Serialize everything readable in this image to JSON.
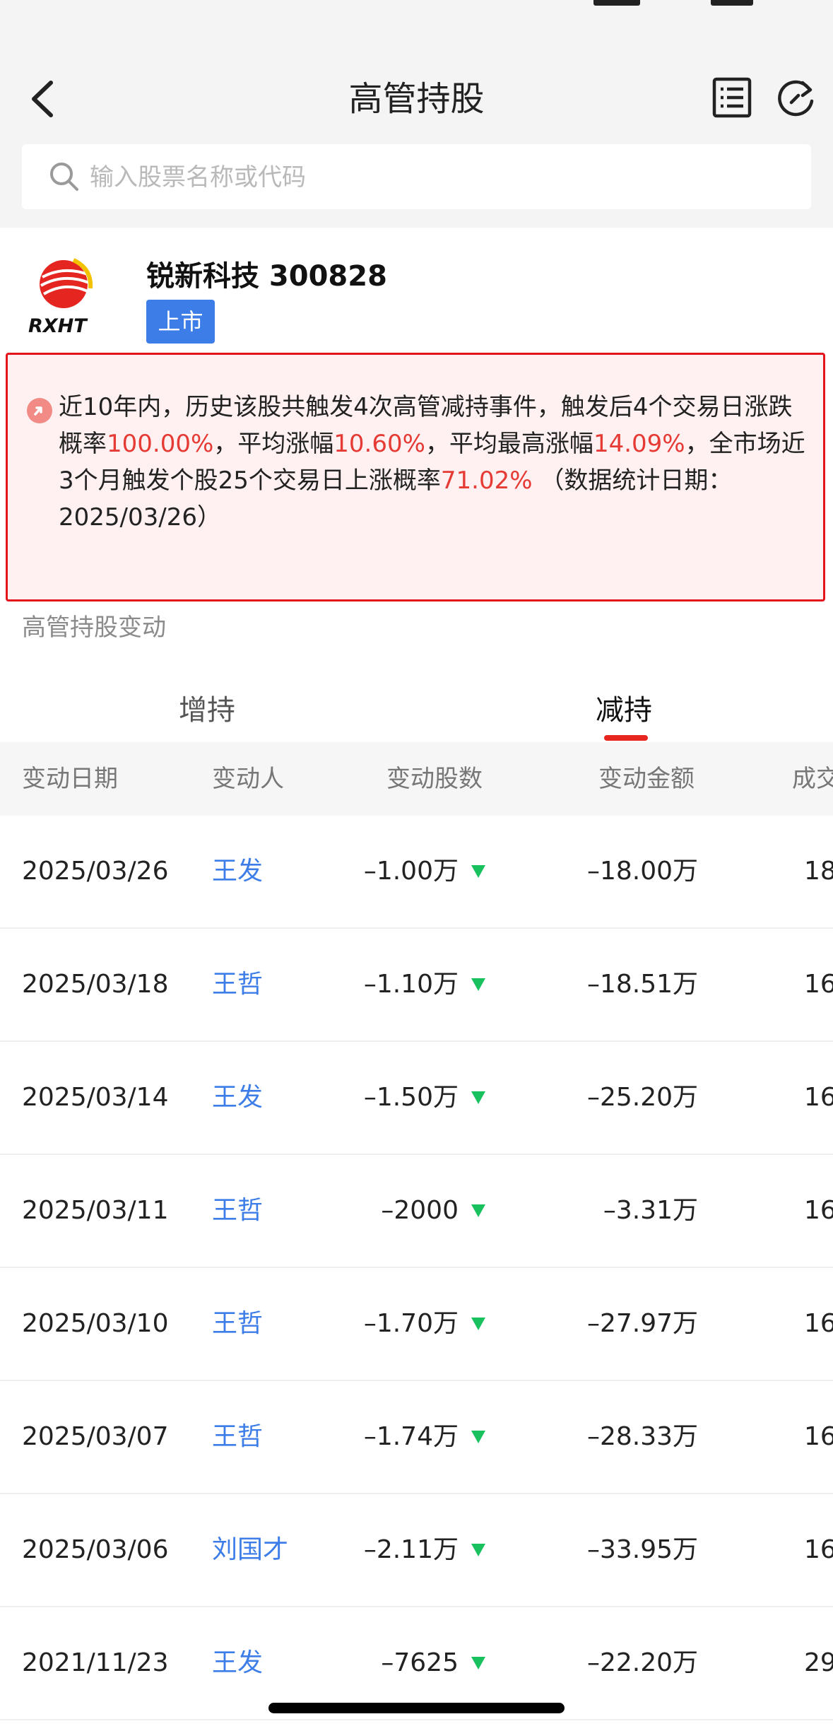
{
  "nav": {
    "title": "高管持股"
  },
  "search": {
    "placeholder": "输入股票名称或代码"
  },
  "stock": {
    "name": "锐新科技 300828",
    "badge": "上市",
    "logo_text": "RXHT"
  },
  "alert": {
    "p1": "近10年内，历史该股共触发4次高管减持事件，触发后4个交易日涨跌概率",
    "v1": "100.00%",
    "p2": "，平均涨幅",
    "v2": "10.60%",
    "p3": "，平均最高涨幅",
    "v3": "14.09%",
    "p4": "，全市场近3个月触发个股25个交易日上涨概率",
    "v4": "71.02%",
    "p5": " （数据统计日期：2025/03/26）"
  },
  "section": {
    "label": "高管持股变动"
  },
  "tabs": [
    {
      "label": "增持",
      "active": false
    },
    {
      "label": "减持",
      "active": true
    }
  ],
  "table": {
    "headers": [
      "变动日期",
      "变动人",
      "变动股数",
      "变动金额",
      "成交"
    ],
    "rows": [
      {
        "date": "2025/03/26",
        "person": "王发",
        "shares": "–1.00万",
        "amount": "–18.00万",
        "price": "18"
      },
      {
        "date": "2025/03/18",
        "person": "王哲",
        "shares": "–1.10万",
        "amount": "–18.51万",
        "price": "16"
      },
      {
        "date": "2025/03/14",
        "person": "王发",
        "shares": "–1.50万",
        "amount": "–25.20万",
        "price": "16"
      },
      {
        "date": "2025/03/11",
        "person": "王哲",
        "shares": "–2000",
        "amount": "–3.31万",
        "price": "16"
      },
      {
        "date": "2025/03/10",
        "person": "王哲",
        "shares": "–1.70万",
        "amount": "–27.97万",
        "price": "16"
      },
      {
        "date": "2025/03/07",
        "person": "王哲",
        "shares": "–1.74万",
        "amount": "–28.33万",
        "price": "16"
      },
      {
        "date": "2025/03/06",
        "person": "刘国才",
        "shares": "–2.11万",
        "amount": "–33.95万",
        "price": "16"
      },
      {
        "date": "2021/11/23",
        "person": "王发",
        "shares": "–7625",
        "amount": "–22.20万",
        "price": "29"
      }
    ]
  },
  "colors": {
    "accent_blue": "#3d7de8",
    "alert_red": "#e3141c",
    "highlight_red": "#e63a35",
    "down_green": "#19c25f"
  }
}
